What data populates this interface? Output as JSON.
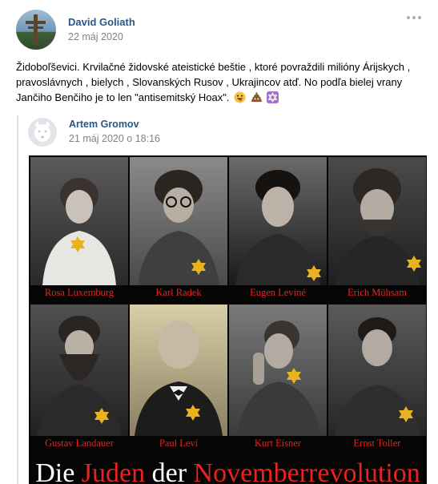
{
  "post": {
    "author": "David Goliath",
    "date": "22 máj 2020",
    "text": "Židoboľševici. Krvilačné židovské ateistické beštie , ktoré povraždili milióny Árijskych , pravoslávnych , bielych , Slovanských Rusov , Ukrajincov atď. No podľa bielej vrany Jančiho Benčiho je to len \"antisemitský Hoax\". ",
    "emoji_icons": [
      "grinning-tongue-emoji",
      "poop-emoji",
      "star-of-david-emoji"
    ]
  },
  "repost": {
    "author": "Artem Gromov",
    "date": "21 máj 2020 o 18:16",
    "image": {
      "names": [
        "Rosa Luxemburg",
        "Karl Radek",
        "Eugen Leviné",
        "Erich Mühsam",
        "Gustav Landauer",
        "Paul Levi",
        "Kurt Eisner",
        "Ernst Toller"
      ],
      "banner_parts": [
        "Die ",
        "Juden",
        " der ",
        "Novemberrevolution"
      ]
    }
  },
  "colors": {
    "link": "#2a5885",
    "muted": "#828282",
    "accent_red": "#e8231f",
    "star_yellow": "#e9b21f"
  }
}
